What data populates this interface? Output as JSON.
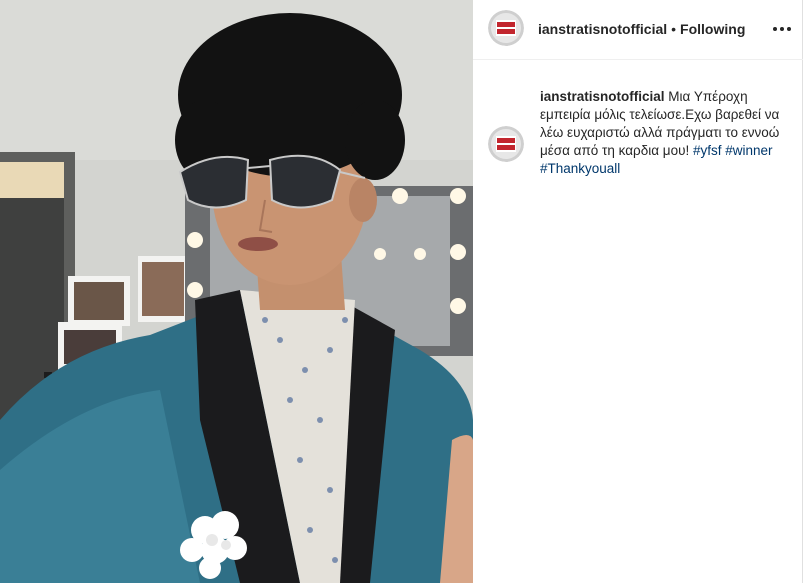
{
  "post": {
    "username": "ianstratisnotofficial",
    "separator": "•",
    "follow_status": "Following",
    "more_label": "More options",
    "caption": {
      "username": "ianstratisnotofficial",
      "text": "Μια Υπέροχη εμπειρία μόλις τελείωσε.Εχω βαρεθεί να λέω ευχαριστώ αλλά πράγματι το εννοώ μέσα από τη καρδια μου!",
      "hashtags": [
        "#yfsf",
        "#winner",
        "#Thankyouall"
      ]
    }
  },
  "colors": {
    "text": "#262626",
    "link": "#00376b",
    "divider": "#efefef"
  },
  "icons": {
    "more": "more-horizontal-icon",
    "avatar": "profile-avatar"
  }
}
